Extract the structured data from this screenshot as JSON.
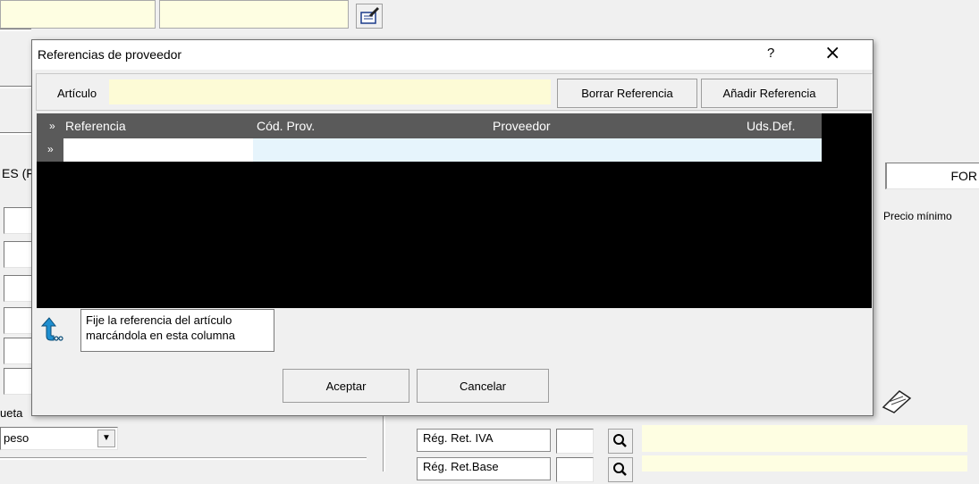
{
  "background": {
    "section_label": "ES (F",
    "right_label": "FOR",
    "precio_minimo_label": "Precio mínimo",
    "etiqueta_label": "ueta",
    "peso_select_value": "peso",
    "reg_ret_iva_label": "Rég. Ret. IVA",
    "reg_ret_base_label": "Rég. Ret.Base"
  },
  "dialog": {
    "title": "Referencias de proveedor",
    "help_glyph": "?",
    "close_glyph": "×",
    "articulo_label": "Artículo",
    "articulo_value": "",
    "borrar_button": "Borrar Referencia",
    "anadir_button": "Añadir Referencia",
    "grid": {
      "indicator_header": "»",
      "columns": [
        "Referencia",
        "Cód. Prov.",
        "Proveedor",
        "Uds.Def."
      ],
      "rows": [
        {
          "indicator": "»",
          "cells": [
            "",
            "",
            "",
            ""
          ]
        }
      ]
    },
    "hint_line1": "Fije la referencia del artículo",
    "hint_line2": "marcándola en esta columna",
    "accept_button": "Aceptar",
    "cancel_button": "Cancelar"
  },
  "colors": {
    "field_yellow": "#fdfbd6",
    "grid_header": "#5a5a5a",
    "row_highlight": "#e6f4fc",
    "hint_arrow": "#1f8fd0"
  }
}
